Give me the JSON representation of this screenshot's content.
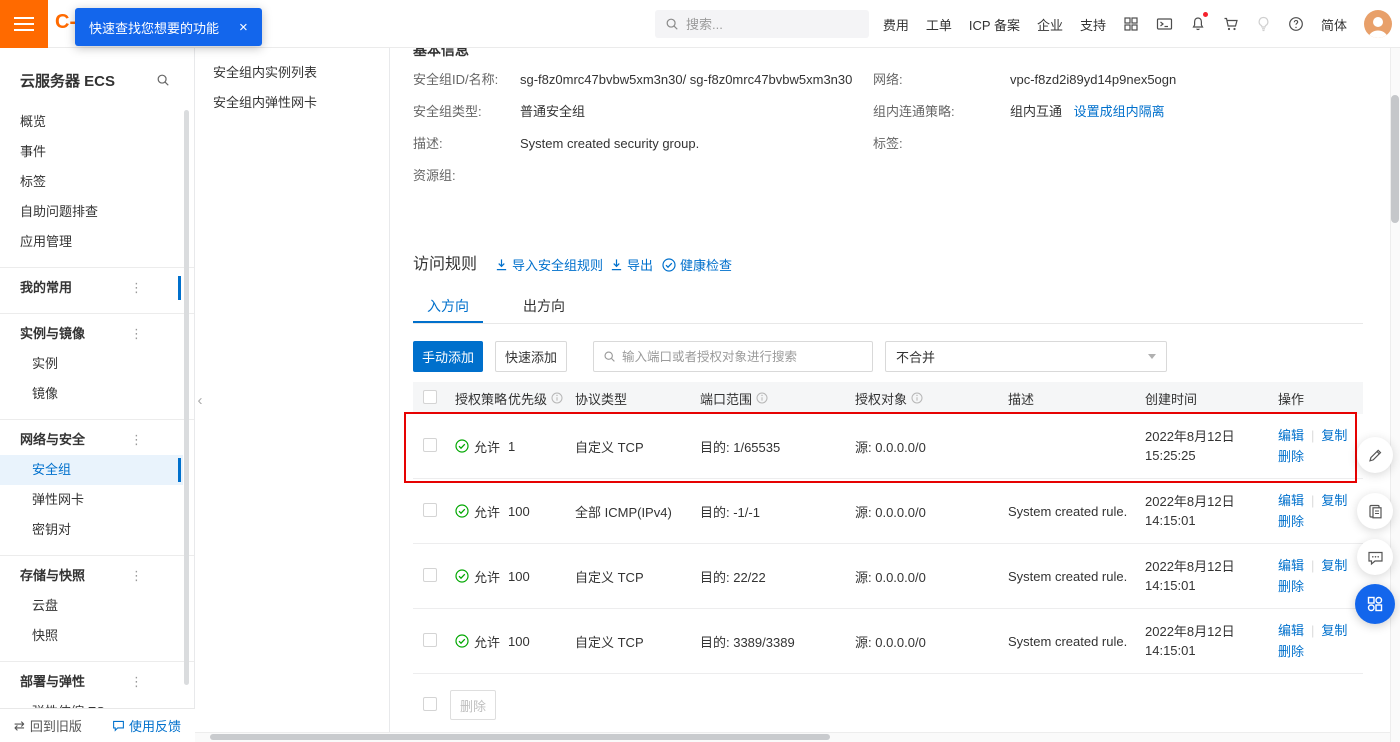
{
  "colors": {
    "brand_orange": "#ff6a00",
    "primary_blue": "#0070cc",
    "tooltip_blue": "#1366ec",
    "success_green": "#00a700",
    "annotation_red": "#e60202"
  },
  "glyphs": {
    "close": "×",
    "more": "⋮",
    "collapse": "‹",
    "swap": "⇄",
    "separator": "|"
  },
  "topbar": {
    "logo_text": "C-",
    "tooltip_text": "快速查找您想要的功能",
    "search_placeholder": "搜索...",
    "nav_items": [
      "费用",
      "工单",
      "ICP 备案",
      "企业",
      "支持"
    ],
    "language": "简体"
  },
  "sidebar": {
    "title": "云服务器 ECS",
    "items": [
      "概览",
      "事件",
      "标签",
      "自助问题排查",
      "应用管理"
    ],
    "my_favorites": "我的常用",
    "groups": [
      {
        "label": "实例与镜像",
        "children": [
          "实例",
          "镜像"
        ]
      },
      {
        "label": "网络与安全",
        "children": [
          "安全组",
          "弹性网卡",
          "密钥对"
        ]
      },
      {
        "label": "存储与快照",
        "children": [
          "云盘",
          "快照"
        ]
      },
      {
        "label": "部署与弹性",
        "children": [
          "弹性伸缩 ES"
        ]
      }
    ],
    "back_to_old": "回到旧版",
    "feedback": "使用反馈"
  },
  "subnav": {
    "items": [
      "安全组内实例列表",
      "安全组内弹性网卡"
    ]
  },
  "basic_info": {
    "title": "基本信息",
    "rows_left": [
      {
        "label": "安全组ID/名称:",
        "value": "sg-f8z0mrc47bvbw5xm3n30/ sg-f8z0mrc47bvbw5xm3n30"
      },
      {
        "label": "安全组类型:",
        "value": "普通安全组"
      },
      {
        "label": "描述:",
        "value": "System created security group."
      },
      {
        "label": "资源组:",
        "value": ""
      }
    ],
    "rows_right": [
      {
        "label": "网络:",
        "value": "vpc-f8zd2i89yd14p9nex5ogn"
      },
      {
        "label": "组内连通策略:",
        "value": "组内互通",
        "link": "设置成组内隔离"
      },
      {
        "label": "标签:",
        "value": ""
      }
    ]
  },
  "rules": {
    "title": "访问规则",
    "import_label": "导入安全组规则",
    "export_label": "导出",
    "health_check_label": "健康检查",
    "tabs": [
      {
        "label": "入方向"
      },
      {
        "label": "出方向"
      }
    ],
    "manual_add": "手动添加",
    "quick_add": "快速添加",
    "search_placeholder": "输入端口或者授权对象进行搜索",
    "merge_selected": "不合并",
    "headers": [
      "授权策略",
      "优先级",
      "协议类型",
      "端口范围",
      "授权对象",
      "描述",
      "创建时间",
      "操作"
    ],
    "rows": [
      {
        "policy": "允许",
        "priority": "1",
        "protocol": "自定义 TCP",
        "port": "目的: 1/65535",
        "source": "源: 0.0.0.0/0",
        "description": "",
        "date": "2022年8月12日",
        "time": "15:25:25"
      },
      {
        "policy": "允许",
        "priority": "100",
        "protocol": "全部 ICMP(IPv4)",
        "port": "目的: -1/-1",
        "source": "源: 0.0.0.0/0",
        "description": "System created rule.",
        "date": "2022年8月12日",
        "time": "14:15:01"
      },
      {
        "policy": "允许",
        "priority": "100",
        "protocol": "自定义 TCP",
        "port": "目的: 22/22",
        "source": "源: 0.0.0.0/0",
        "description": "System created rule.",
        "date": "2022年8月12日",
        "time": "14:15:01"
      },
      {
        "policy": "允许",
        "priority": "100",
        "protocol": "自定义 TCP",
        "port": "目的: 3389/3389",
        "source": "源: 0.0.0.0/0",
        "description": "System created rule.",
        "date": "2022年8月12日",
        "time": "14:15:01"
      }
    ],
    "actions": {
      "edit": "编辑",
      "copy": "复制",
      "delete": "删除"
    },
    "batch_delete": "删除"
  }
}
